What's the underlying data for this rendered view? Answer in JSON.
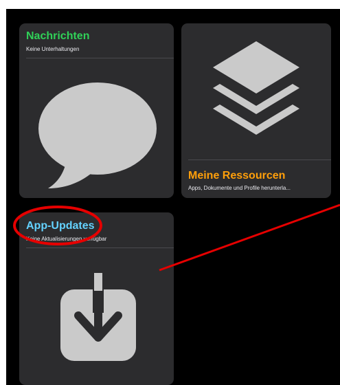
{
  "tiles": {
    "messages": {
      "title": "Nachrichten",
      "subtitle": "Keine Unterhaltungen",
      "title_color": "#30d158",
      "icon": "speech-bubble-icon"
    },
    "resources": {
      "title": "Meine Ressourcen",
      "subtitle": "Apps, Dokumente und Profile herunterla...",
      "title_color": "#ff9f0a",
      "icon": "layers-icon"
    },
    "updates": {
      "title": "App-Updates",
      "subtitle": "Keine Aktualisierungen verfügbar",
      "title_color": "#64d2ff",
      "icon": "download-tray-icon"
    }
  },
  "annotation": {
    "color": "#e60000"
  }
}
